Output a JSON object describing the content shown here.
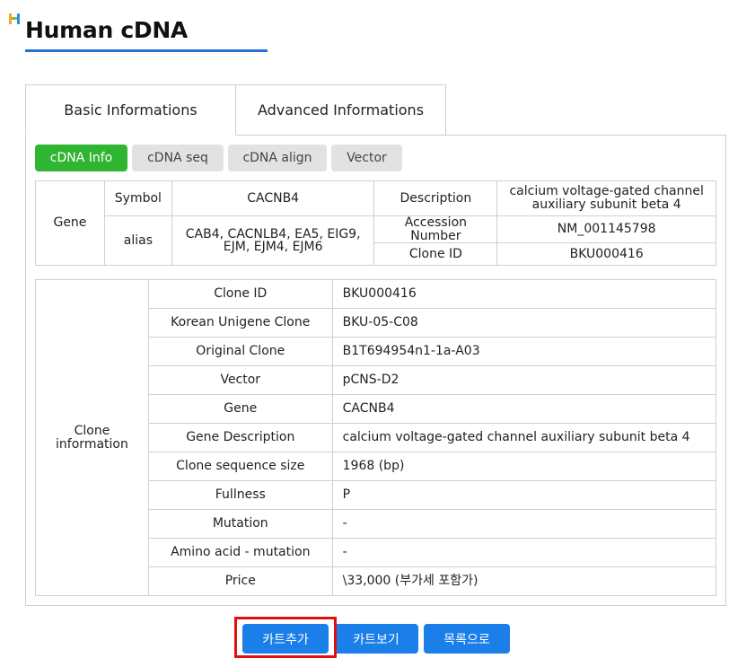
{
  "page": {
    "title": "Human cDNA"
  },
  "tabs": [
    {
      "label": "Basic Informations",
      "active": true
    },
    {
      "label": "Advanced Informations",
      "active": false
    }
  ],
  "subtabs": [
    {
      "label": "cDNA Info",
      "active": true
    },
    {
      "label": "cDNA seq",
      "active": false
    },
    {
      "label": "cDNA align",
      "active": false
    },
    {
      "label": "Vector",
      "active": false
    }
  ],
  "gene_table": {
    "group_label": "Gene",
    "symbol_label": "Symbol",
    "symbol_value": "CACNB4",
    "alias_label": "alias",
    "alias_value": "CAB4, CACNLB4, EA5, EIG9, EJM, EJM4, EJM6",
    "description_label": "Description",
    "description_value": "calcium voltage-gated channel auxiliary subunit beta 4",
    "accession_label": "Accession Number",
    "accession_value": "NM_001145798",
    "clone_id_label": "Clone ID",
    "clone_id_value": "BKU000416"
  },
  "clone_table": {
    "group_label": "Clone information",
    "rows": [
      {
        "label": "Clone ID",
        "value": "BKU000416"
      },
      {
        "label": "Korean Unigene Clone",
        "value": "BKU-05-C08"
      },
      {
        "label": "Original Clone",
        "value": "B1T694954n1-1a-A03"
      },
      {
        "label": "Vector",
        "value": "pCNS-D2"
      },
      {
        "label": "Gene",
        "value": "CACNB4"
      },
      {
        "label": "Gene Description",
        "value": "calcium voltage-gated channel auxiliary subunit beta 4"
      },
      {
        "label": "Clone sequence size",
        "value": "1968 (bp)"
      },
      {
        "label": "Fullness",
        "value": "P"
      },
      {
        "label": "Mutation",
        "value": "-"
      },
      {
        "label": "Amino acid - mutation",
        "value": "-"
      },
      {
        "label": "Price",
        "value": "\\33,000 (부가세 포함가)"
      }
    ]
  },
  "buttons": {
    "add_cart": "카트추가",
    "view_cart": "카트보기",
    "to_list": "목록으로"
  },
  "colors": {
    "accent_blue": "#2a6fd6",
    "button_blue": "#1a7fe8",
    "active_green": "#2fb532",
    "highlight_red": "#e01010"
  },
  "icons": {
    "logo": "logo-h-icon"
  }
}
